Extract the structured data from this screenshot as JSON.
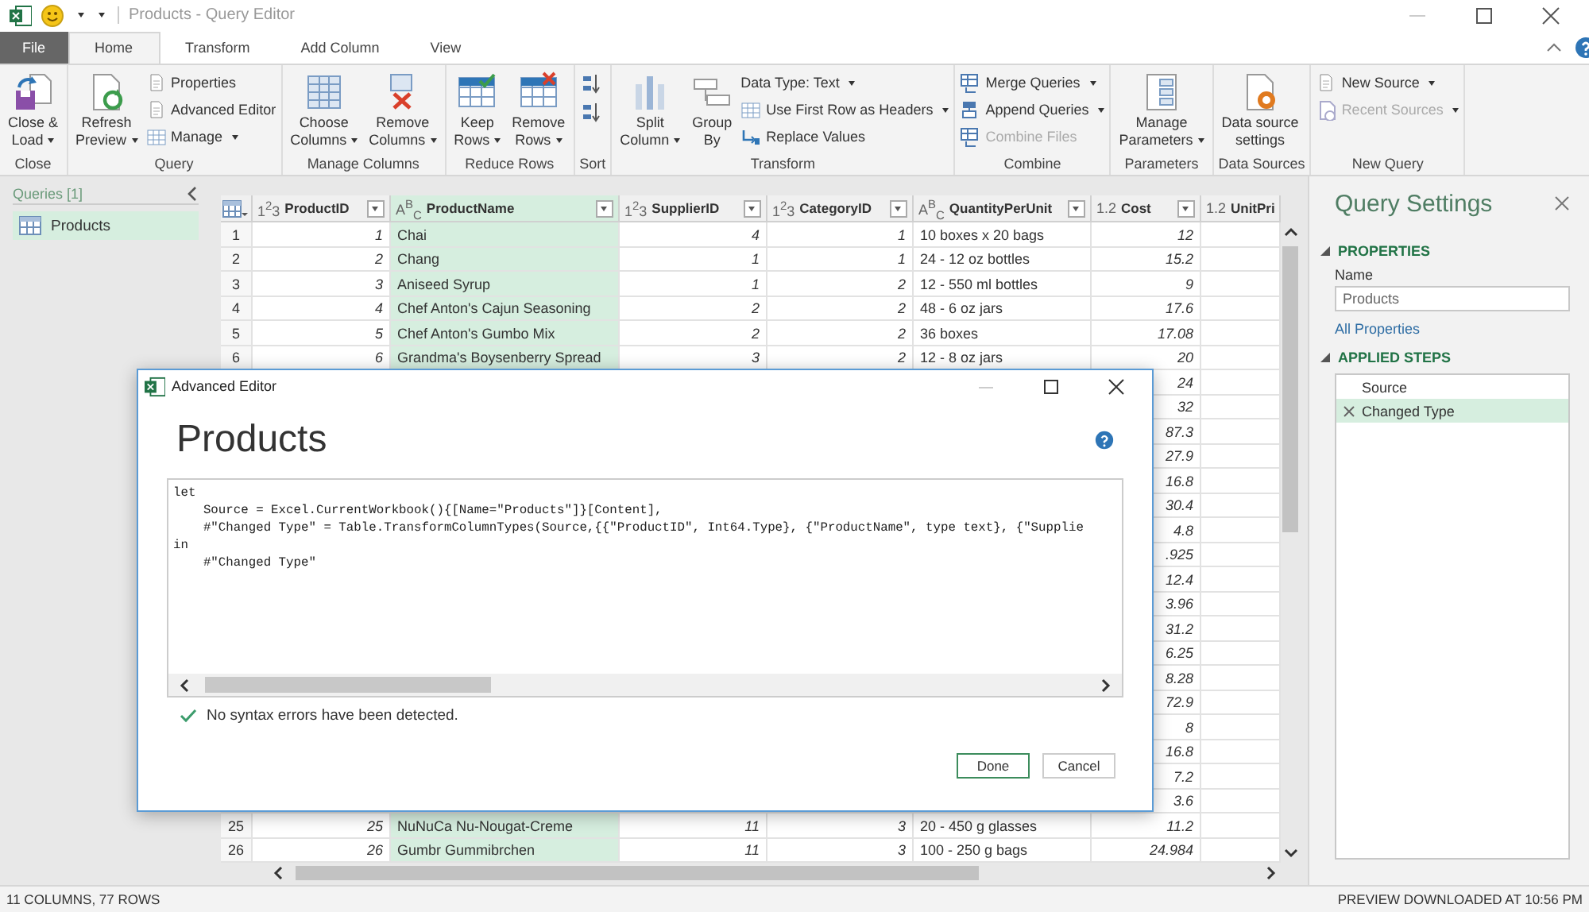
{
  "window": {
    "title": "Products - Query Editor"
  },
  "tabs": [
    {
      "label": "File",
      "kind": "file",
      "selected": false
    },
    {
      "label": "Home",
      "kind": "tab",
      "selected": true
    },
    {
      "label": "Transform",
      "kind": "tab",
      "selected": false
    },
    {
      "label": "Add Column",
      "kind": "tab",
      "selected": false
    },
    {
      "label": "View",
      "kind": "tab",
      "selected": false
    }
  ],
  "ribbon": {
    "groups": [
      {
        "label": "Close",
        "items": [
          {
            "kind": "large",
            "label": "Close &\nLoad",
            "dropdown": true
          }
        ]
      },
      {
        "label": "Query",
        "items": [
          {
            "kind": "large",
            "label": "Refresh\nPreview",
            "dropdown": true
          },
          {
            "kind": "stack",
            "buttons": [
              {
                "kind": "small",
                "label": "Properties",
                "dropdown": false,
                "disabled": false
              },
              {
                "kind": "small",
                "label": "Advanced Editor",
                "dropdown": false,
                "disabled": false
              },
              {
                "kind": "small",
                "label": "Manage",
                "dropdown": true,
                "disabled": false
              }
            ]
          }
        ]
      },
      {
        "label": "Manage Columns",
        "items": [
          {
            "kind": "large",
            "label": "Choose\nColumns",
            "dropdown": true
          },
          {
            "kind": "large",
            "label": "Remove\nColumns",
            "dropdown": true
          }
        ]
      },
      {
        "label": "Reduce Rows",
        "items": [
          {
            "kind": "large",
            "label": "Keep\nRows",
            "dropdown": true
          },
          {
            "kind": "large",
            "label": "Remove\nRows",
            "dropdown": true
          }
        ]
      },
      {
        "label": "Sort",
        "items": [
          {
            "kind": "stack",
            "buttons": [
              {
                "kind": "icon"
              },
              {
                "kind": "icon"
              }
            ]
          }
        ]
      },
      {
        "label": "Transform",
        "items": [
          {
            "kind": "large",
            "label": "Split\nColumn",
            "dropdown": true
          },
          {
            "kind": "large",
            "label": "Group\nBy",
            "dropdown": false
          },
          {
            "kind": "stack",
            "buttons": [
              {
                "kind": "small",
                "label": "Data Type: Text",
                "dropdown": true,
                "disabled": false
              },
              {
                "kind": "small",
                "label": "Use First Row as Headers",
                "dropdown": true,
                "disabled": false
              },
              {
                "kind": "small",
                "label": "Replace Values",
                "dropdown": false,
                "disabled": false
              }
            ]
          }
        ]
      },
      {
        "label": "Combine",
        "items": [
          {
            "kind": "stack",
            "buttons": [
              {
                "kind": "small",
                "label": "Merge Queries",
                "dropdown": true,
                "disabled": false
              },
              {
                "kind": "small",
                "label": "Append Queries",
                "dropdown": true,
                "disabled": false
              },
              {
                "kind": "small",
                "label": "Combine Files",
                "dropdown": false,
                "disabled": true
              }
            ]
          }
        ]
      },
      {
        "label": "Parameters",
        "items": [
          {
            "kind": "large",
            "label": "Manage\nParameters",
            "dropdown": true
          }
        ]
      },
      {
        "label": "Data Sources",
        "items": [
          {
            "kind": "large",
            "label": "Data source\nsettings",
            "dropdown": false
          }
        ]
      },
      {
        "label": "New Query",
        "items": [
          {
            "kind": "stack",
            "buttons": [
              {
                "kind": "small",
                "label": "New Source",
                "dropdown": true,
                "disabled": false
              },
              {
                "kind": "small",
                "label": "Recent Sources",
                "dropdown": true,
                "disabled": true
              }
            ]
          }
        ]
      }
    ]
  },
  "queries": {
    "title": "Queries [1]",
    "items": [
      {
        "label": "Products",
        "selected": true
      }
    ]
  },
  "table": {
    "columns": [
      {
        "type": "1$^{2}$3",
        "name": "ProductID",
        "kind": "number",
        "selected": false,
        "filter_button": true
      },
      {
        "type": "A$^{B}$$_{C}$",
        "name": "ProductName",
        "kind": "text",
        "selected": true,
        "filter_button": true
      },
      {
        "type": "1$^{2}$3",
        "name": "SupplierID",
        "kind": "number",
        "selected": false,
        "filter_button": true
      },
      {
        "type": "1$^{2}$3",
        "name": "CategoryID",
        "kind": "number",
        "selected": false,
        "filter_button": true
      },
      {
        "type": "A$^{B}$$_{C}$",
        "name": "QuantityPerUnit",
        "kind": "text",
        "selected": false,
        "filter_button": true
      },
      {
        "type": "1.2",
        "name": "Cost",
        "kind": "number",
        "selected": false,
        "filter_button": true
      },
      {
        "type": "1.2",
        "name": "UnitPri",
        "kind": "number",
        "selected": false
      }
    ],
    "rows": [
      {
        "kind": "full",
        "num": "1",
        "cells": [
          "1",
          "Chai",
          "4",
          "1",
          "10 boxes x 20 bags",
          "12"
        ]
      },
      {
        "kind": "full",
        "num": "2",
        "cells": [
          "2",
          "Chang",
          "1",
          "1",
          "24 - 12 oz bottles",
          "15.2"
        ]
      },
      {
        "kind": "full",
        "num": "3",
        "cells": [
          "3",
          "Aniseed Syrup",
          "1",
          "2",
          "12 - 550 ml bottles",
          "9"
        ]
      },
      {
        "kind": "full",
        "num": "4",
        "cells": [
          "4",
          "Chef Anton's Cajun Seasoning",
          "2",
          "2",
          "48 - 6 oz jars",
          "17.6"
        ]
      },
      {
        "kind": "full",
        "num": "5",
        "cells": [
          "5",
          "Chef Anton's Gumbo Mix",
          "2",
          "2",
          "36 boxes",
          "17.08"
        ]
      },
      {
        "kind": "full",
        "num": "6",
        "cells": [
          "6",
          "Grandma's Boysenberry Spread",
          "3",
          "2",
          "12 - 8 oz jars",
          "20"
        ]
      },
      {
        "kind": "covered",
        "cost": "24"
      },
      {
        "kind": "covered",
        "cost": "32"
      },
      {
        "kind": "covered",
        "cost": "87.3"
      },
      {
        "kind": "covered",
        "cost": "27.9"
      },
      {
        "kind": "covered",
        "cost": "16.8"
      },
      {
        "kind": "covered",
        "cost": "30.4"
      },
      {
        "kind": "covered",
        "cost": "4.8"
      },
      {
        "kind": "covered",
        "cost": ".925"
      },
      {
        "kind": "covered",
        "cost": "12.4"
      },
      {
        "kind": "covered",
        "cost": "3.96"
      },
      {
        "kind": "covered",
        "cost": "31.2"
      },
      {
        "kind": "covered",
        "cost": "6.25"
      },
      {
        "kind": "covered",
        "cost": "8.28"
      },
      {
        "kind": "covered",
        "cost": "72.9"
      },
      {
        "kind": "covered",
        "cost": "8"
      },
      {
        "kind": "covered",
        "cost": "16.8"
      },
      {
        "kind": "covered",
        "cost": "7.2"
      },
      {
        "kind": "covered",
        "cost": "3.6"
      },
      {
        "kind": "full",
        "num": "25",
        "cells": [
          "25",
          "NuNuCa Nu-Nougat-Creme",
          "11",
          "3",
          "20 - 450 g glasses",
          "11.2"
        ]
      },
      {
        "kind": "full",
        "num": "26",
        "cells": [
          "26",
          "Gumbr Gummibrchen",
          "11",
          "3",
          "100 - 250 g bags",
          "24.984"
        ]
      }
    ]
  },
  "dialog": {
    "title": "Advanced Editor",
    "heading": "Products",
    "code": [
      "let",
      "    Source = Excel.CurrentWorkbook(){[Name=\"Products\"]}[Content],",
      "    #\"Changed Type\" = Table.TransformColumnTypes(Source,{{\"ProductID\", Int64.Type}, {\"ProductName\", type text}, {\"Supplie",
      "in",
      "    #\"Changed Type\""
    ],
    "status": "No syntax errors have been detected.",
    "buttons": [
      {
        "label": "Done",
        "primary": true
      },
      {
        "label": "Cancel",
        "primary": false
      }
    ]
  },
  "settings": {
    "title": "Query Settings",
    "properties_heading": "PROPERTIES",
    "name_label": "Name",
    "name_value": "Products",
    "all_properties": "All Properties",
    "steps_heading": "APPLIED STEPS",
    "steps": [
      {
        "label": "Source",
        "selected": false
      },
      {
        "label": "Changed Type",
        "selected": true
      }
    ]
  },
  "status_bar": {
    "left": "11 COLUMNS, 77 ROWS",
    "right": "PREVIEW DOWNLOADED AT 10:56 PM"
  }
}
